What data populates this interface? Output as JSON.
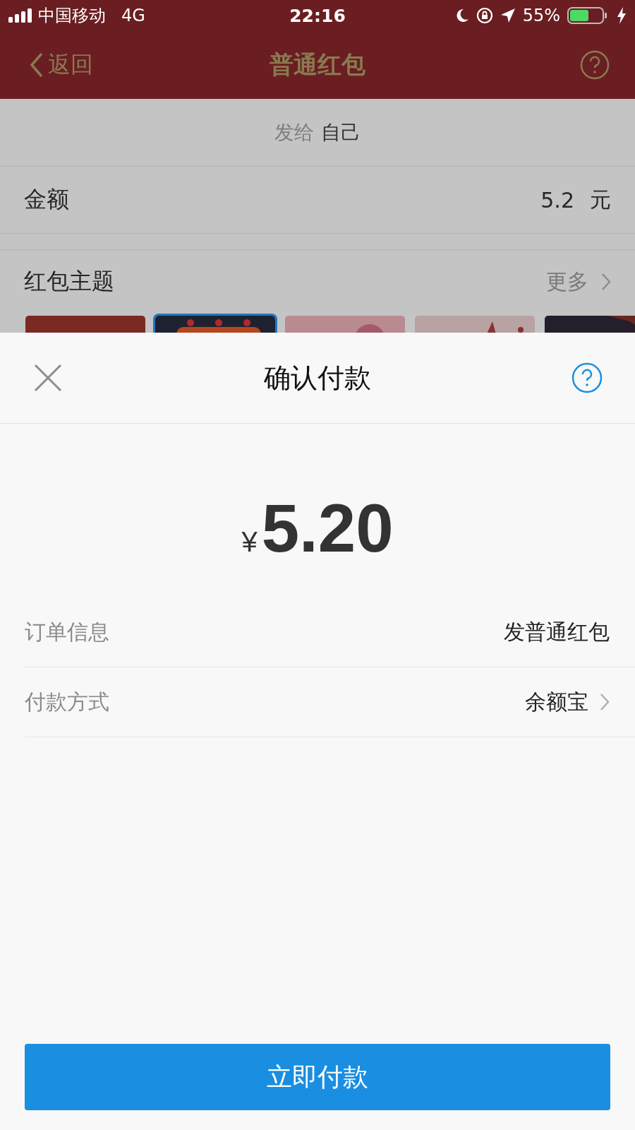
{
  "status_bar": {
    "carrier": "中国移动",
    "network": "4G",
    "time": "22:16",
    "battery": "55%"
  },
  "nav": {
    "back": "返回",
    "title": "普通红包"
  },
  "recipient": {
    "label": "发给",
    "value": "自己"
  },
  "amount": {
    "label": "金额",
    "value": "5.2",
    "unit": "元"
  },
  "theme": {
    "label": "红包主题",
    "more": "更多"
  },
  "theme_cards": [
    {
      "kind": "picture",
      "selected": false
    },
    {
      "kind": "picture",
      "selected": true
    },
    {
      "kind": "picture",
      "selected": false
    },
    {
      "kind": "picture",
      "selected": false
    },
    {
      "kind": "picture",
      "selected": false
    }
  ],
  "sheet": {
    "title": "确认付款",
    "currency": "¥",
    "amount": "5.20",
    "rows": [
      {
        "label": "订单信息",
        "value": "发普通红包",
        "chevron": false
      },
      {
        "label": "付款方式",
        "value": "余额宝",
        "chevron": true
      }
    ],
    "pay_button": "立即付款"
  }
}
